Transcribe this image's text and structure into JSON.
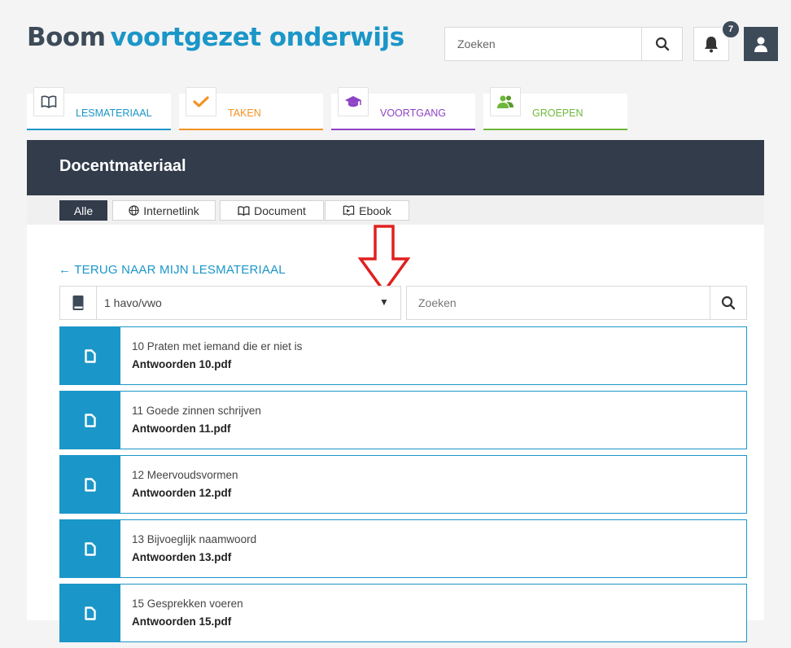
{
  "header": {
    "logo_part1": "Boom",
    "logo_part2": "voortgezet onderwijs",
    "search_placeholder": "Zoeken",
    "notification_count": "7"
  },
  "tabs": [
    {
      "label": "LESMATERIAAL",
      "color": "#1b96c8",
      "icon": "book-icon"
    },
    {
      "label": "TAKEN",
      "color": "#f39223",
      "icon": "check-icon"
    },
    {
      "label": "VOORTGANG",
      "color": "#8e44c6",
      "icon": "graduation-cap-icon"
    },
    {
      "label": "GROEPEN",
      "color": "#6fb73a",
      "icon": "users-icon"
    }
  ],
  "panel": {
    "title": "Docentmateriaal",
    "filters": [
      {
        "label": "Alle",
        "active": true
      },
      {
        "label": "Internetlink",
        "icon": "globe-icon"
      },
      {
        "label": "Document",
        "icon": "book-icon"
      },
      {
        "label": "Ebook",
        "icon": "ebook-icon"
      }
    ],
    "back_link": "← TERUG NAAR MIJN LESMATERIAAL",
    "method_select_value": "1 havo/vwo",
    "list_search_placeholder": "Zoeken"
  },
  "items": [
    {
      "chapter": "10 Praten met iemand die er niet is",
      "file": "Antwoorden 10.pdf"
    },
    {
      "chapter": "11 Goede zinnen schrijven",
      "file": "Antwoorden 11.pdf"
    },
    {
      "chapter": "12 Meervoudsvormen",
      "file": "Antwoorden 12.pdf"
    },
    {
      "chapter": "13 Bijvoeglijk naamwoord",
      "file": "Antwoorden 13.pdf"
    },
    {
      "chapter": "15 Gesprekken voeren",
      "file": "Antwoorden 15.pdf"
    }
  ],
  "colors": {
    "accent": "#1b96c8",
    "dark": "#323c4b",
    "annotation_arrow": "#e02020"
  }
}
